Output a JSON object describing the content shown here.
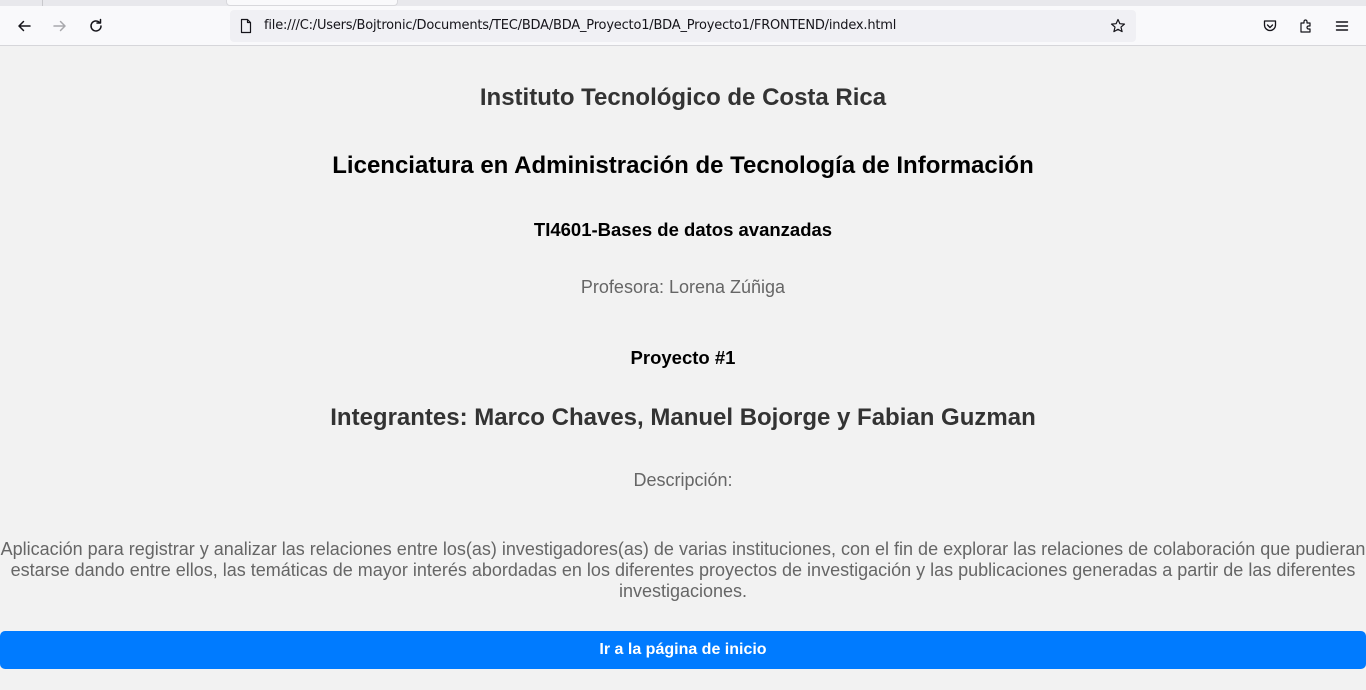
{
  "browser": {
    "url": "file:///C:/Users/Bojtronic/Documents/TEC/BDA/BDA_Proyecto1/BDA_Proyecto1/FRONTEND/index.html",
    "icons": {
      "back": "back-arrow-icon",
      "forward": "forward-arrow-icon",
      "reload": "reload-icon",
      "page": "page-icon",
      "bookmark": "star-icon",
      "pocket": "pocket-icon",
      "extensions": "extensions-icon",
      "menu": "hamburger-menu-icon"
    }
  },
  "page": {
    "institution": "Instituto Tecnológico de Costa Rica",
    "degree": "Licenciatura en Administración de Tecnología de Información",
    "course": "TI4601-Bases de datos avanzadas",
    "professor": "Profesora: Lorena Zúñiga",
    "project": "Proyecto #1",
    "members": "Integrantes: Marco Chaves, Manuel Bojorge y Fabian Guzman",
    "description_label": "Descripción:",
    "description": "Aplicación para registrar y analizar las relaciones entre los(as) investigadores(as) de varias instituciones, con el fin de explorar las relaciones de colaboración que pudieran estarse dando entre ellos, las temáticas de mayor interés abordadas en los diferentes proyectos de investigación y las publicaciones generadas a partir de las diferentes investigaciones.",
    "start_button": "Ir a la página de inicio"
  },
  "colors": {
    "button": "#007bff",
    "background": "#f2f2f2"
  }
}
